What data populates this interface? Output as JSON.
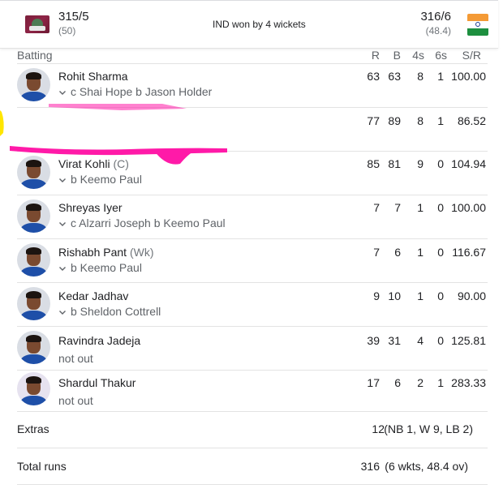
{
  "header": {
    "team1": {
      "score": "315/5",
      "overs": "(50)",
      "flag": "west-indies-flag"
    },
    "result": "IND won by 4 wickets",
    "team2": {
      "score": "316/6",
      "overs": "(48.4)",
      "flag": "india-flag"
    }
  },
  "table": {
    "columns": {
      "batting": "Batting",
      "r": "R",
      "b": "B",
      "fours": "4s",
      "sixes": "6s",
      "sr": "S/R"
    },
    "rows": [
      {
        "name": "Rohit Sharma",
        "role": "",
        "dismissal": "c Shai Hope b Jason Holder",
        "expandable": true,
        "r": "63",
        "b": "63",
        "fours": "8",
        "sixes": "1",
        "sr": "100.00"
      },
      {
        "name": "",
        "role": "",
        "dismissal": "",
        "expandable": false,
        "r": "77",
        "b": "89",
        "fours": "8",
        "sixes": "1",
        "sr": "86.52"
      },
      {
        "name": "Virat Kohli",
        "role": "(C)",
        "dismissal": "b Keemo Paul",
        "expandable": true,
        "r": "85",
        "b": "81",
        "fours": "9",
        "sixes": "0",
        "sr": "104.94"
      },
      {
        "name": "Shreyas Iyer",
        "role": "",
        "dismissal": "c Alzarri Joseph b Keemo Paul",
        "expandable": true,
        "r": "7",
        "b": "7",
        "fours": "1",
        "sixes": "0",
        "sr": "100.00"
      },
      {
        "name": "Rishabh Pant",
        "role": "(Wk)",
        "dismissal": "b Keemo Paul",
        "expandable": true,
        "r": "7",
        "b": "6",
        "fours": "1",
        "sixes": "0",
        "sr": "116.67"
      },
      {
        "name": "Kedar Jadhav",
        "role": "",
        "dismissal": "b Sheldon Cottrell",
        "expandable": true,
        "r": "9",
        "b": "10",
        "fours": "1",
        "sixes": "0",
        "sr": "90.00"
      },
      {
        "name": "Ravindra Jadeja",
        "role": "",
        "dismissal": "not out",
        "expandable": false,
        "r": "39",
        "b": "31",
        "fours": "4",
        "sixes": "0",
        "sr": "125.81"
      },
      {
        "name": "Shardul Thakur",
        "role": "",
        "dismissal": "not out",
        "expandable": false,
        "r": "17",
        "b": "6",
        "fours": "2",
        "sixes": "1",
        "sr": "283.33"
      }
    ],
    "extras": {
      "label": "Extras",
      "value": "12",
      "detail": "(NB 1, W 9, LB 2)"
    },
    "total": {
      "label": "Total runs",
      "value": "316",
      "detail": "(6 wkts, 48.4 ov)"
    }
  },
  "colors": {
    "scribble_pink": "#ff1aa8",
    "scribble_yellow": "#ffe600"
  }
}
